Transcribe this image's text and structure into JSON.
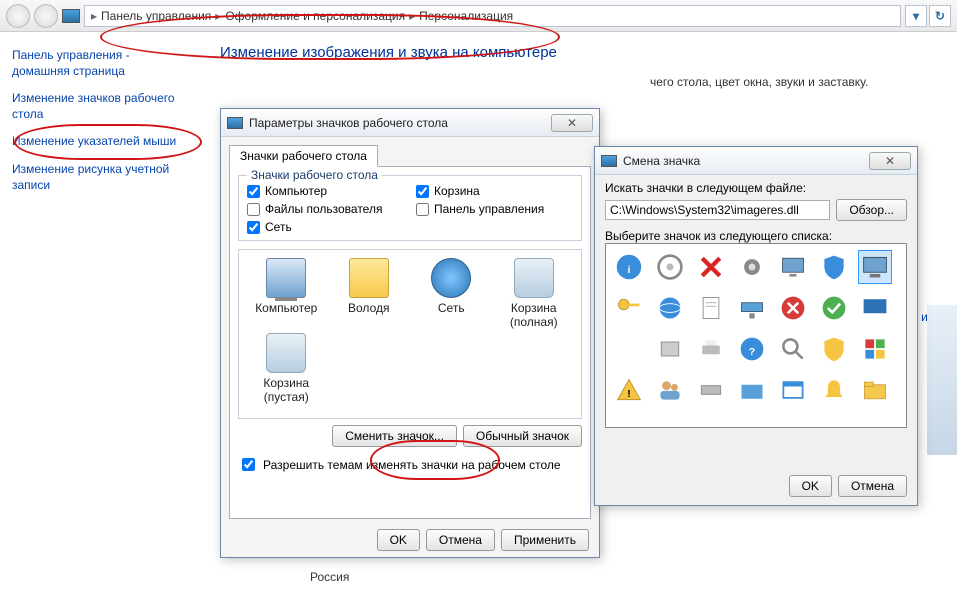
{
  "breadcrumb": {
    "items": [
      "Панель управления",
      "Оформление и персонализация",
      "Персонализация"
    ]
  },
  "sidebar": {
    "home": "Панель управления - домашняя страница",
    "links": [
      "Изменение значков рабочего стола",
      "Изменение указателей мыши",
      "Изменение рисунка учетной записи"
    ]
  },
  "main": {
    "title": "Изменение изображения и звука на компьютере",
    "desc_fragment": "чего стола, цвет окна, звуки и заставку.",
    "footer_country": "Россия",
    "side_link": "ить те"
  },
  "dlg1": {
    "title": "Параметры значков рабочего стола",
    "tab": "Значки рабочего стола",
    "group_title": "Значки рабочего стола",
    "checkboxes": {
      "computer": "Компьютер",
      "recycle": "Корзина",
      "userfiles": "Файлы пользователя",
      "cpanel": "Панель управления",
      "network": "Сеть"
    },
    "icons": {
      "computer": "Компьютер",
      "user_folder": "Володя",
      "network": "Сеть",
      "bin_full": "Корзина (полная)",
      "bin_empty": "Корзина (пустая)"
    },
    "change_icon_btn": "Сменить значок...",
    "default_icon_btn": "Обычный значок",
    "allow_themes": "Разрешить темам изменять значки на рабочем столе",
    "ok": "OK",
    "cancel": "Отмена",
    "apply": "Применить"
  },
  "dlg2": {
    "title": "Смена значка",
    "search_label": "Искать значки в следующем файле:",
    "path": "C:\\Windows\\System32\\imageres.dll",
    "browse": "Обзор...",
    "select_label": "Выберите значок из следующего списка:",
    "ok": "OK",
    "cancel": "Отмена"
  }
}
